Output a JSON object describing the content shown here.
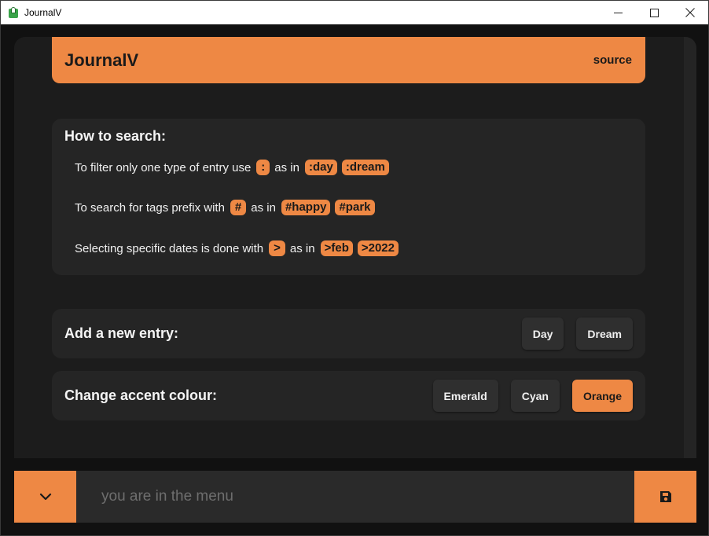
{
  "window": {
    "title": "JournalV",
    "controls": {
      "minimize": "—",
      "maximize": "☐",
      "close": "✕"
    }
  },
  "header": {
    "title": "JournalV",
    "link": "source"
  },
  "help": {
    "title": "How to search:",
    "lines": [
      {
        "text": "To filter only one type of entry use",
        "operator": ":",
        "as_in": "as in",
        "examples": [
          ":day",
          ":dream"
        ]
      },
      {
        "text": "To search for tags prefix with",
        "operator": "#",
        "as_in": "as in",
        "examples": [
          "#happy",
          "#park"
        ]
      },
      {
        "text": "Selecting specific dates is done with",
        "operator": ">",
        "as_in": "as in",
        "examples": [
          ">feb",
          ">2022"
        ]
      }
    ]
  },
  "add_entry": {
    "title": "Add a new entry:",
    "buttons": [
      "Day",
      "Dream"
    ]
  },
  "accent": {
    "title": "Change accent colour:",
    "buttons": [
      "Emerald",
      "Cyan",
      "Orange"
    ],
    "selected": "Orange"
  },
  "bottom": {
    "search_placeholder": "you are in the menu",
    "search_value": "",
    "toggle_icon": "chevron-down-icon",
    "save_icon": "save-icon"
  },
  "colors": {
    "accent": "#ee8844",
    "background": "#111111",
    "panel": "#1c1c1c",
    "card": "#252525",
    "button": "#2f2f2f"
  }
}
